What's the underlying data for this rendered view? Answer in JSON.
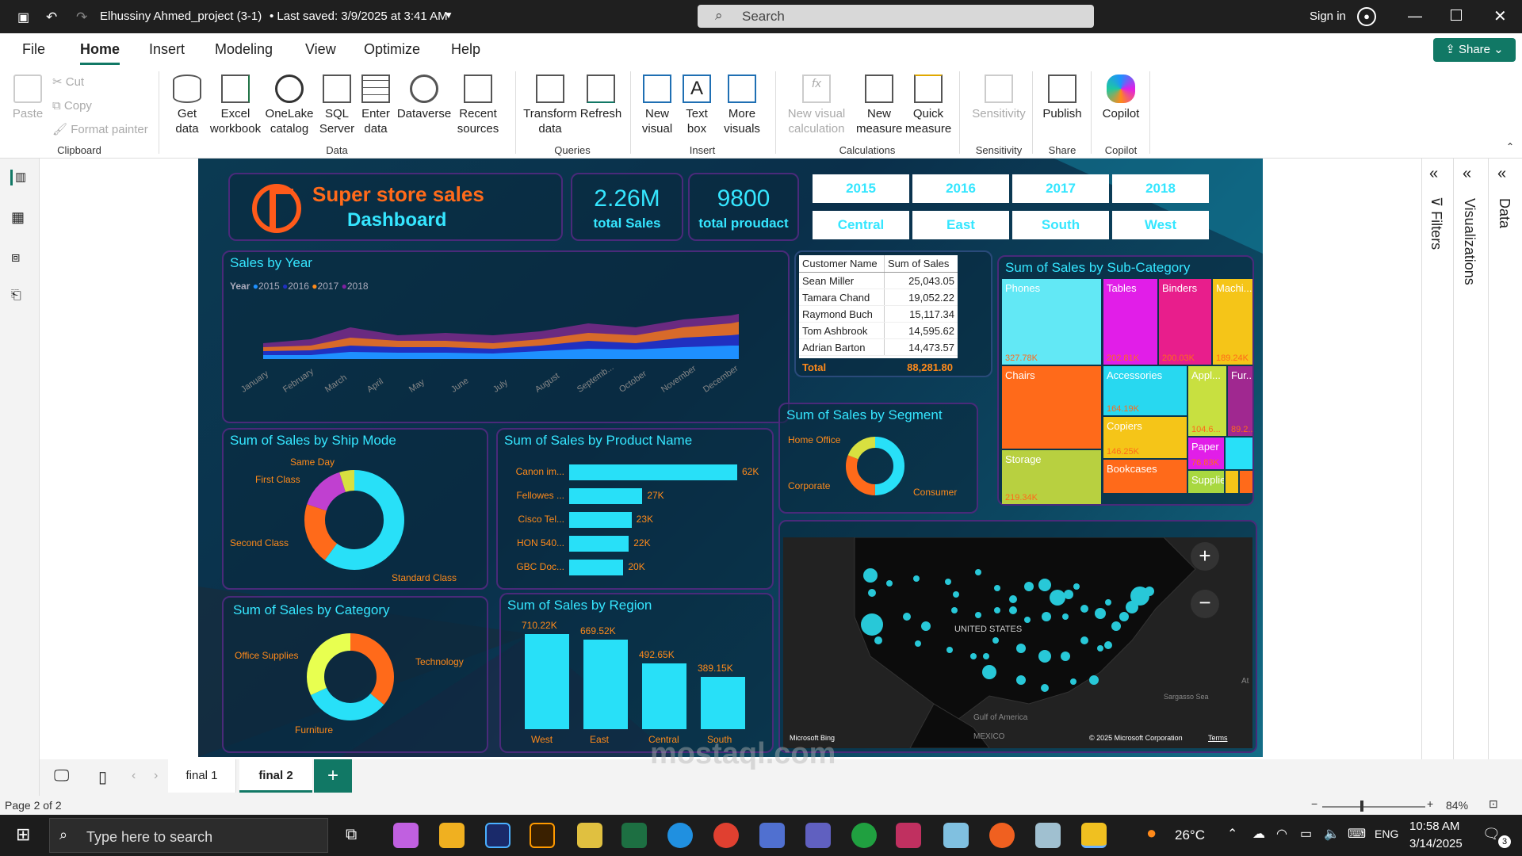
{
  "titlebar": {
    "title": "Elhussiny Ahmed_project (3-1)",
    "saved": "• Last saved: 3/9/2025 at 3:41 AM",
    "search_placeholder": "Search",
    "signin": "Sign in"
  },
  "menu": [
    "File",
    "Home",
    "Insert",
    "Modeling",
    "View",
    "Optimize",
    "Help"
  ],
  "share_label": "Share",
  "ribbon": {
    "clipboard": {
      "paste": "Paste",
      "cut": "Cut",
      "copy": "Copy",
      "format_painter": "Format painter",
      "group": "Clipboard"
    },
    "data": {
      "get_data": "Get data",
      "excel": "Excel workbook",
      "onelake": "OneLake catalog",
      "sql": "SQL Server",
      "enter": "Enter data",
      "dataverse": "Dataverse",
      "recent": "Recent sources",
      "group": "Data"
    },
    "queries": {
      "transform": "Transform data",
      "refresh": "Refresh",
      "group": "Queries"
    },
    "insert": {
      "new_visual": "New visual",
      "text_box": "Text box",
      "more_visuals": "More visuals",
      "group": "Insert"
    },
    "calculations": {
      "new_visual_calc": "New visual calculation",
      "new_measure": "New measure",
      "quick_measure": "Quick measure",
      "group": "Calculations"
    },
    "sensitivity": {
      "label": "Sensitivity",
      "group": "Sensitivity"
    },
    "share": {
      "publish": "Publish",
      "group": "Share"
    },
    "copilot": {
      "label": "Copilot",
      "group": "Copilot"
    }
  },
  "dashboard": {
    "title_line1": "Super store sales",
    "title_line2": "Dashboard",
    "kpi_sales_value": "2.26M",
    "kpi_sales_label": "total Sales",
    "kpi_product_value": "9800",
    "kpi_product_label": "total proudact",
    "year_slicers": [
      "2015",
      "2016",
      "2017",
      "2018"
    ],
    "region_slicers": [
      "Central",
      "East",
      "South",
      "West"
    ],
    "sales_by_year": {
      "title": "Sales by Year",
      "legend_title": "Year",
      "legend": [
        "2015",
        "2016",
        "2017",
        "2018"
      ],
      "months": [
        "January",
        "February",
        "March",
        "April",
        "May",
        "June",
        "July",
        "August",
        "Septemb...",
        "October",
        "November",
        "December"
      ]
    },
    "customer_table": {
      "headers": [
        "Customer Name",
        "Sum of Sales"
      ],
      "rows": [
        [
          "Sean Miller",
          "25,043.05"
        ],
        [
          "Tamara Chand",
          "19,052.22"
        ],
        [
          "Raymond Buch",
          "15,117.34"
        ],
        [
          "Tom Ashbrook",
          "14,595.62"
        ],
        [
          "Adrian Barton",
          "14,473.57"
        ]
      ],
      "total_label": "Total",
      "total_value": "88,281.80"
    },
    "subcategory": {
      "title": "Sum of Sales by Sub-Category",
      "items": [
        {
          "name": "Phones",
          "value": "327.78K",
          "color": "#62e8f5"
        },
        {
          "name": "Tables",
          "value": "202.81K",
          "color": "#e11ee8"
        },
        {
          "name": "Binders",
          "value": "200.03K",
          "color": "#e81e8c"
        },
        {
          "name": "Machi...",
          "value": "189.24K",
          "color": "#f5c518"
        },
        {
          "name": "Chairs",
          "value": "",
          "color": "#ff6a1a"
        },
        {
          "name": "Accessories",
          "value": "164.19K",
          "color": "#28d8f0"
        },
        {
          "name": "Appl...",
          "value": "104.6...",
          "color": "#c8e040"
        },
        {
          "name": "Fur...",
          "value": "89.2...",
          "color": "#a02890"
        },
        {
          "name": "Copiers",
          "value": "146.25K",
          "color": "#f5c518"
        },
        {
          "name": "Storage",
          "value": "219.34K",
          "color": "#b8d040"
        },
        {
          "name": "Bookcases",
          "value": "",
          "color": "#ff6a1a"
        },
        {
          "name": "Paper",
          "value": "76.83K",
          "color": "#e11ee8"
        },
        {
          "name": "Supplies",
          "value": "",
          "color": "#a8d840"
        }
      ]
    },
    "ship_mode": {
      "title": "Sum of Sales by Ship Mode",
      "labels": [
        "Same Day",
        "First Class",
        "Second Class",
        "Standard Class"
      ]
    },
    "product": {
      "title": "Sum of Sales by Product Name",
      "names": [
        "Canon im...",
        "Fellowes ...",
        "Cisco Tel...",
        "HON 540...",
        "GBC Doc..."
      ],
      "values": [
        62,
        27,
        23,
        22,
        20
      ],
      "labels": [
        "62K",
        "27K",
        "23K",
        "22K",
        "20K"
      ]
    },
    "segment": {
      "title": "Sum of Sales by Segment",
      "labels": [
        "Home Office",
        "Corporate",
        "Consumer"
      ]
    },
    "category": {
      "title": "Sum of Sales by Category",
      "labels": [
        "Office Supplies",
        "Technology",
        "Furniture"
      ]
    },
    "region": {
      "title": "Sum of Sales by Region",
      "categories": [
        "West",
        "East",
        "Central",
        "South"
      ],
      "values": [
        710.22,
        669.52,
        492.65,
        389.15
      ],
      "labels": [
        "710.22K",
        "669.52K",
        "492.65K",
        "389.15K"
      ]
    },
    "map": {
      "country": "UNITED STATES",
      "mexico": "MEXICO",
      "gulf": "Gulf of America",
      "sargasso": "Sargasso Sea",
      "bing": "Microsoft Bing",
      "copyright": "© 2025 Microsoft Corporation",
      "terms": "Terms",
      "at": "At"
    }
  },
  "side_panels": [
    "Filters",
    "Visualizations",
    "Data"
  ],
  "pages": [
    "final 1",
    "final 2"
  ],
  "status": {
    "page": "Page 2 of 2",
    "zoom": "84%"
  },
  "taskbar": {
    "search": "Type here to search",
    "temp": "26°C",
    "lang": "ENG",
    "time": "10:58 AM",
    "date": "3/14/2025",
    "notif": "3"
  },
  "watermark": "mostaql.com",
  "chart_data": [
    {
      "type": "bar",
      "title": "Sum of Sales by Product Name",
      "categories": [
        "Canon im...",
        "Fellowes ...",
        "Cisco Tel...",
        "HON 540...",
        "GBC Doc..."
      ],
      "values": [
        62,
        27,
        23,
        22,
        20
      ]
    },
    {
      "type": "bar",
      "title": "Sum of Sales by Region",
      "categories": [
        "West",
        "East",
        "Central",
        "South"
      ],
      "values": [
        710.22,
        669.52,
        492.65,
        389.15
      ]
    },
    {
      "type": "pie",
      "title": "Sum of Sales by Ship Mode",
      "categories": [
        "Standard Class",
        "Second Class",
        "First Class",
        "Same Day"
      ],
      "values": [
        60,
        20,
        15,
        5
      ]
    },
    {
      "type": "pie",
      "title": "Sum of Sales by Segment",
      "categories": [
        "Consumer",
        "Corporate",
        "Home Office"
      ],
      "values": [
        50,
        31,
        19
      ]
    },
    {
      "type": "pie",
      "title": "Sum of Sales by Category",
      "categories": [
        "Technology",
        "Furniture",
        "Office Supplies"
      ],
      "values": [
        36,
        32,
        32
      ]
    }
  ]
}
